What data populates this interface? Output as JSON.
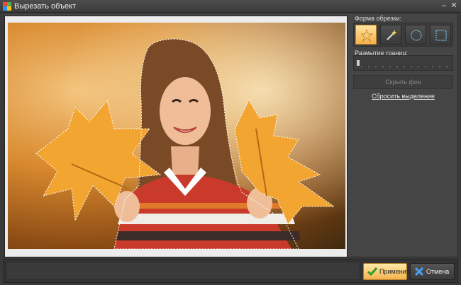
{
  "window": {
    "title": "Вырезать объект",
    "min_glyph": "–",
    "close_glyph": "✕"
  },
  "panel": {
    "shape_label": "Форма обрезки:",
    "shapes": [
      {
        "name": "star",
        "icon": "star-icon",
        "active": true
      },
      {
        "name": "magic-wand",
        "icon": "magic-wand-icon",
        "active": false
      },
      {
        "name": "ellipse",
        "icon": "ellipse-icon",
        "active": false
      },
      {
        "name": "rectangle",
        "icon": "rectangle-icon",
        "active": false
      }
    ],
    "blur_label": "Размытие границ:",
    "blur_value": 0,
    "hide_bg_label": "Скрыть фон",
    "reset_label": "Сбросить выделение"
  },
  "footer": {
    "apply_label": "Применить",
    "cancel_label": "Отмена"
  },
  "colors": {
    "accent": "#f4b24c",
    "background": "#3a3a3a"
  }
}
